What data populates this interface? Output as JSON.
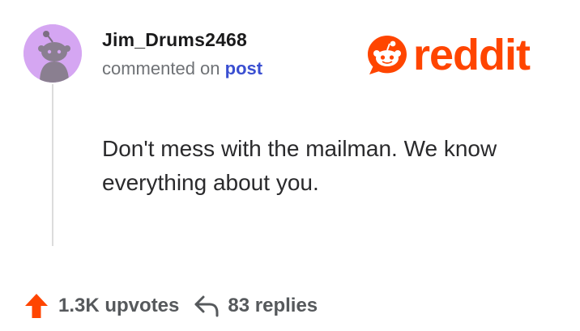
{
  "comment": {
    "username": "Jim_Drums2468",
    "meta_prefix": "commented on",
    "meta_link": "post",
    "text": "Don't mess with the mailman. We know everything about you."
  },
  "brand": {
    "wordmark": "reddit",
    "color": "#ff4500",
    "icon": "reddit-snoo-icon"
  },
  "avatar": {
    "icon": "snoo-avatar-icon",
    "background": "#d5a6f2"
  },
  "stats": {
    "upvotes": "1.3K upvotes",
    "replies": "83 replies",
    "upvote_icon": "upvote-arrow-icon",
    "reply_icon": "reply-arrow-icon",
    "upvote_color": "#ff4500"
  }
}
